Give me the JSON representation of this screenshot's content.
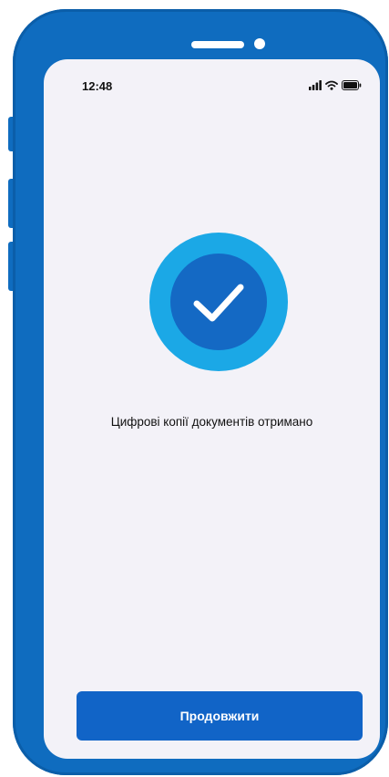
{
  "status_bar": {
    "time": "12:48",
    "icons": [
      "signal-icon",
      "wifi-icon",
      "battery-icon"
    ]
  },
  "success": {
    "icon": "checkmark-icon",
    "message": "Цифрові копії документів отримано"
  },
  "actions": {
    "continue_label": "Продовжити"
  },
  "colors": {
    "frame": "#0f6cbf",
    "screen_background": "#f3f2f8",
    "circle_outer": "#1ba8e6",
    "circle_inner": "#1469c4",
    "button": "#1164c7"
  }
}
